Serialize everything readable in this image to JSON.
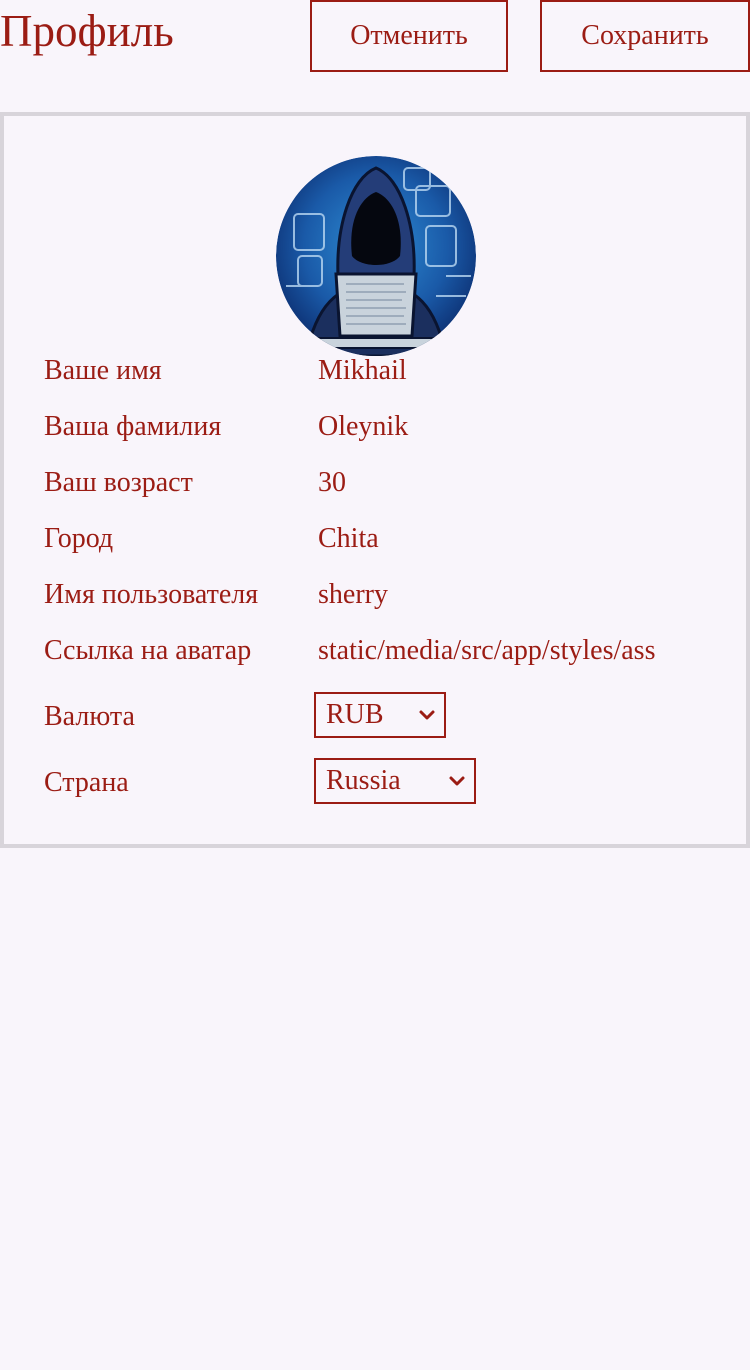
{
  "header": {
    "title": "Профиль",
    "cancel_label": "Отменить",
    "save_label": "Сохранить"
  },
  "profile": {
    "avatar_icon": "hacker-avatar-icon",
    "fields": [
      {
        "label": "Ваше имя",
        "value": "Mikhail"
      },
      {
        "label": "Ваша фамилия",
        "value": "Oleynik"
      },
      {
        "label": "Ваш возраст",
        "value": "30"
      },
      {
        "label": "Город",
        "value": "Chita"
      },
      {
        "label": "Имя пользователя",
        "value": "sherry"
      },
      {
        "label": "Ссылка на аватар",
        "value": "static/media/src/app/styles/ass"
      }
    ],
    "currency": {
      "label": "Валюта",
      "selected": "RUB"
    },
    "country": {
      "label": "Страна",
      "selected": "Russia"
    }
  },
  "colors": {
    "accent": "#9b1c14",
    "background": "#f9f5fb",
    "card_border": "#d8d4da"
  }
}
